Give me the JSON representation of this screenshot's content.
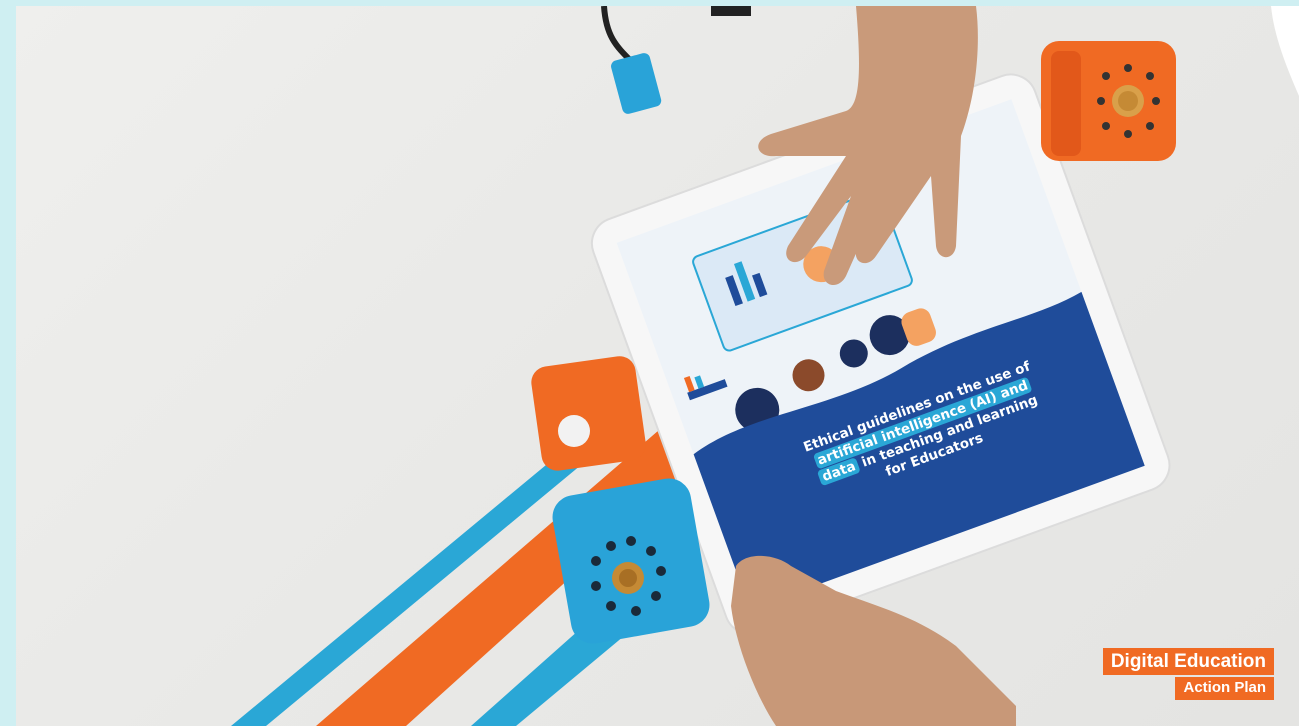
{
  "tablet_screen": {
    "line1": "Ethical guidelines on the use of",
    "line2_highlight": "artificial intelligence (AI) and",
    "line3_highlight": "data",
    "line3_rest": " in teaching and learning",
    "line4": "for Educators"
  },
  "badge": {
    "line1": "Digital Education",
    "line2": "Action Plan"
  },
  "colors": {
    "frame": "#cfeff2",
    "orange": "#f06a23",
    "blue": "#2aa7d6",
    "navy": "#1f4c9a"
  }
}
